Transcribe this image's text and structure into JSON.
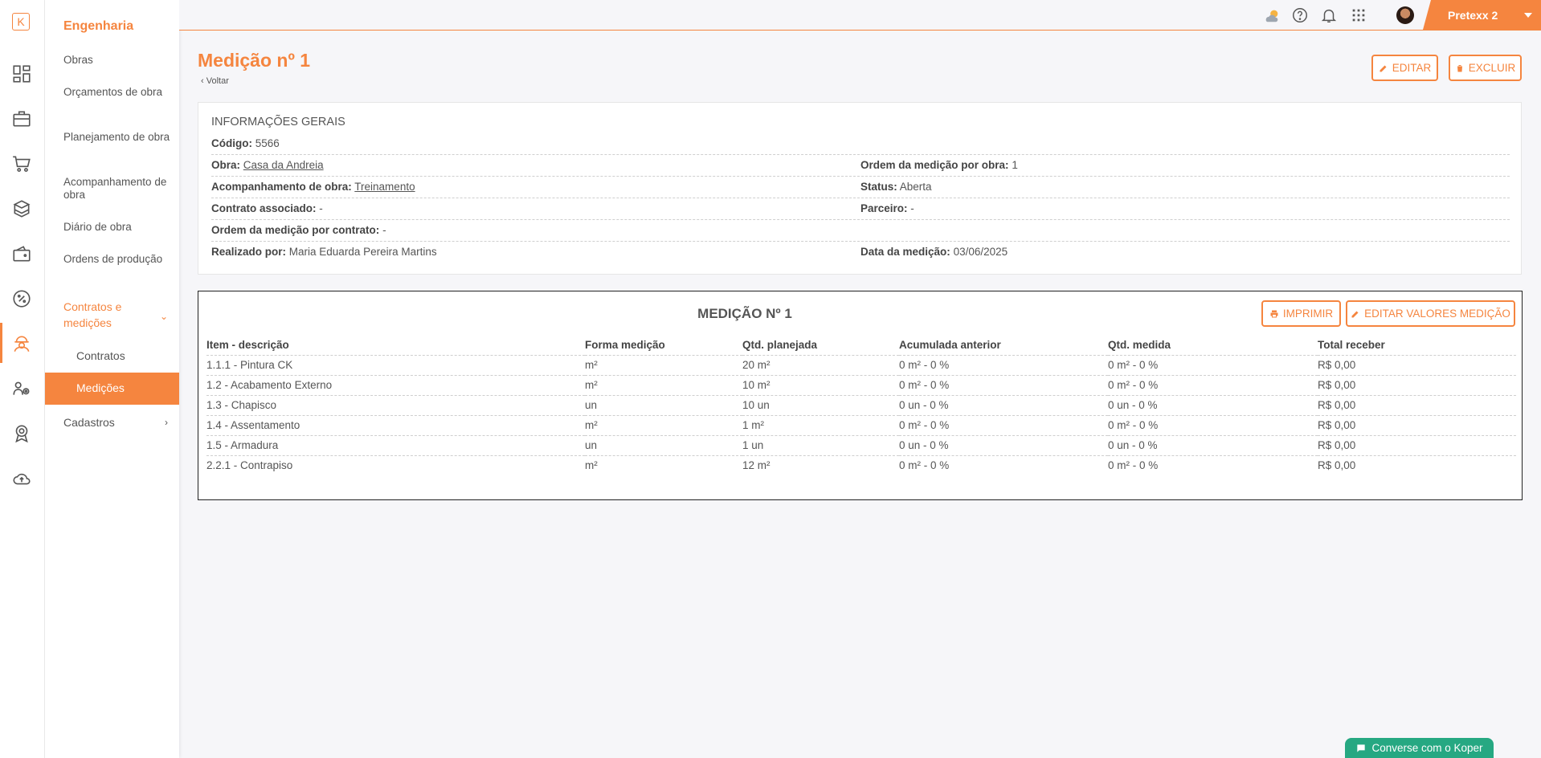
{
  "rail": {
    "logo": "K"
  },
  "sidebar": {
    "title": "Engenharia",
    "items": [
      "Obras",
      "Orçamentos de obra",
      "Planejamento de obra",
      "Acompanhamento de obra",
      "Diário de obra",
      "Ordens de produção",
      "Contratos e medições",
      "Cadastros"
    ],
    "subitems": [
      "Contratos",
      "Medições"
    ]
  },
  "topbar": {
    "user": "Pretexx 2"
  },
  "page": {
    "title": "Medição nº 1",
    "back": "Voltar",
    "edit": "EDITAR",
    "delete": "EXCLUIR"
  },
  "info": {
    "heading": "INFORMAÇÕES GERAIS",
    "codigo_label": "Código:",
    "codigo": "5566",
    "obra_label": "Obra:",
    "obra": "Casa da Andreia",
    "ordem_obra_label": "Ordem da medição por obra:",
    "ordem_obra": "1",
    "acomp_label": "Acompanhamento de obra:",
    "acomp": "Treinamento",
    "status_label": "Status:",
    "status": "Aberta",
    "contrato_label": "Contrato associado:",
    "contrato": "-",
    "parceiro_label": "Parceiro:",
    "parceiro": "-",
    "ordem_contrato_label": "Ordem da medição por contrato:",
    "ordem_contrato": "-",
    "realizado_label": "Realizado por:",
    "realizado": "Maria Eduarda Pereira Martins",
    "data_label": "Data da medição:",
    "data": "03/06/2025"
  },
  "measurement": {
    "title": "MEDIÇÃO Nº 1",
    "print": "IMPRIMIR",
    "edit_values": "EDITAR VALORES MEDIÇÃO",
    "columns": [
      "Item - descrição",
      "Forma medição",
      "Qtd. planejada",
      "Acumulada anterior",
      "Qtd. medida",
      "Total receber"
    ],
    "rows": [
      [
        "1.1.1 - Pintura CK",
        "m²",
        "20 m²",
        "0 m² - 0 %",
        "0 m² - 0 %",
        "R$ 0,00"
      ],
      [
        "1.2 - Acabamento Externo",
        "m²",
        "10 m²",
        "0 m² - 0 %",
        "0 m² - 0 %",
        "R$ 0,00"
      ],
      [
        "1.3 - Chapisco",
        "un",
        "10 un",
        "0 un - 0 %",
        "0 un - 0 %",
        "R$ 0,00"
      ],
      [
        "1.4 - Assentamento",
        "m²",
        "1 m²",
        "0 m² - 0 %",
        "0 m² - 0 %",
        "R$ 0,00"
      ],
      [
        "1.5 - Armadura",
        "un",
        "1 un",
        "0 un - 0 %",
        "0 un - 0 %",
        "R$ 0,00"
      ],
      [
        "2.2.1 - Contrapiso",
        "m²",
        "12 m²",
        "0 m² - 0 %",
        "0 m² - 0 %",
        "R$ 0,00"
      ]
    ]
  },
  "chat": {
    "label": "Converse com o Koper"
  }
}
